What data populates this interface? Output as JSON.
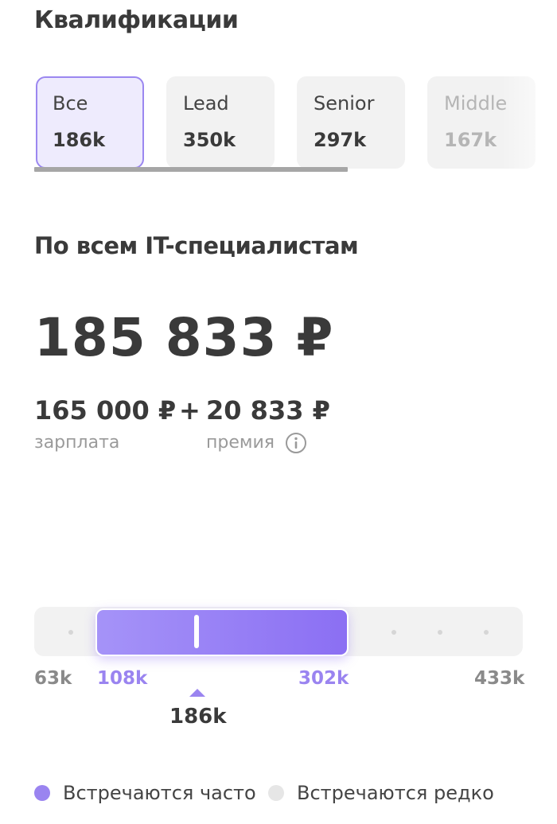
{
  "section_title": "Квалификации",
  "tabs": [
    {
      "label": "Все",
      "count": "186k",
      "active": true
    },
    {
      "label": "Lead",
      "count": "350k"
    },
    {
      "label": "Senior",
      "count": "297k"
    },
    {
      "label": "Middle",
      "count": "167k"
    }
  ],
  "subtitle": "По всем IT-специалистам",
  "total": "185 833 ₽",
  "salary": {
    "value": "165 000 ₽",
    "label": "зарплата"
  },
  "plus": "+",
  "bonus": {
    "value": "20 833 ₽",
    "label": "премия"
  },
  "scale": {
    "min": "63k",
    "range_low": "108k",
    "range_high": "302k",
    "max": "433k",
    "median": "186k"
  },
  "legend": {
    "frequent": "Встречаются часто",
    "rare": "Встречаются редко"
  },
  "colors": {
    "accent": "#9a84f0",
    "rare": "#e6e6e6"
  }
}
